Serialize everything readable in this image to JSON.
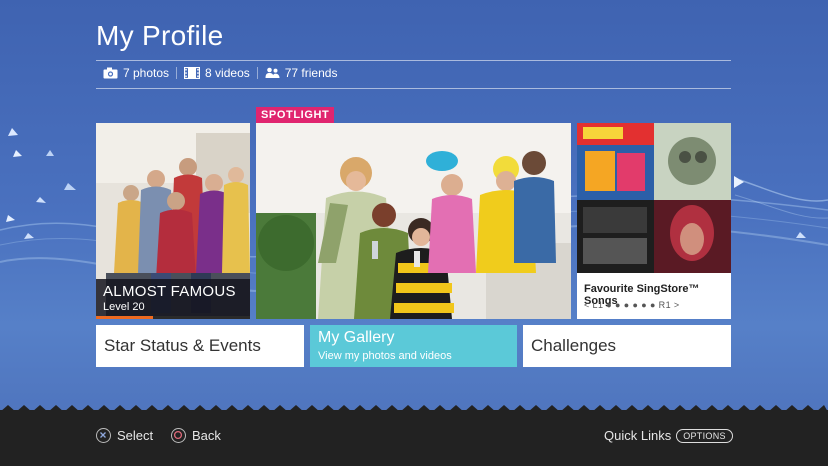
{
  "header": {
    "title": "My Profile"
  },
  "stats": [
    {
      "icon": "camera-icon",
      "label": "7 photos"
    },
    {
      "icon": "film-icon",
      "label": "8 videos"
    },
    {
      "icon": "friends-icon",
      "label": "77 friends"
    }
  ],
  "tiles": {
    "almost_famous": {
      "title": "ALMOST FAMOUS",
      "level": "Level 20",
      "level_progress": 0.37
    },
    "spotlight": {
      "badge": "SPOTLIGHT"
    },
    "singstore": {
      "title": "Favourite SingStore™ Songs",
      "nav": "< L1 ● ● ● ● ● ● R1 >"
    }
  },
  "buttons": {
    "star_status": "Star Status & Events",
    "gallery_title": "My Gallery",
    "gallery_sub": "View my photos and videos",
    "challenges": "Challenges"
  },
  "footer": {
    "select": "Select",
    "back": "Back",
    "quick_links": "Quick Links",
    "options": "OPTIONS"
  },
  "colors": {
    "background": "#4a71bf",
    "spotlight_badge": "#e0256f",
    "gallery_tile": "#5bc9d8",
    "level_bar": "#ef6a1f",
    "footer": "#222222"
  }
}
